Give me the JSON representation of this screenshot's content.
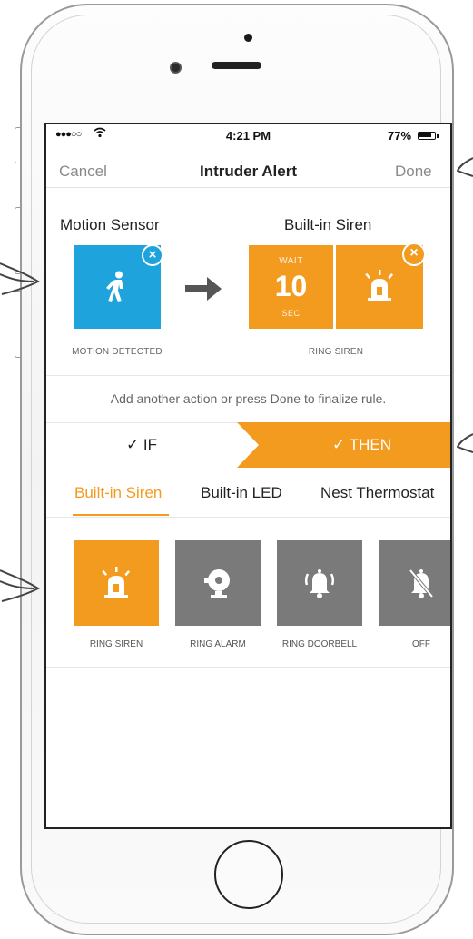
{
  "status_bar": {
    "signal": "●●●○○",
    "time": "4:21 PM",
    "battery": "77%",
    "battery_level": 0.77
  },
  "nav": {
    "cancel": "Cancel",
    "title": "Intruder Alert",
    "done": "Done"
  },
  "rule": {
    "trigger": {
      "device": "Motion Sensor",
      "caption": "MOTION DETECTED",
      "icon": "walking-person-icon",
      "color": "#1fa3dc"
    },
    "action": {
      "device": "Built-in Siren",
      "wait_label": "WAIT",
      "wait_value": "10",
      "wait_unit": "SEC",
      "caption": "RING SIREN",
      "icon": "siren-icon",
      "color": "#f39b1f"
    }
  },
  "hint": "Add another action or press Done to finalize rule.",
  "steps": {
    "if": "✓ IF",
    "then": "✓ THEN"
  },
  "tabs": [
    "Built-in Siren",
    "Built-in LED",
    "Nest Thermostat"
  ],
  "actions": [
    {
      "label": "RING SIREN",
      "icon": "siren-icon",
      "selected": true
    },
    {
      "label": "RING ALARM",
      "icon": "alarm-bell-icon",
      "selected": false
    },
    {
      "label": "RING DOORBELL",
      "icon": "ringing-bell-icon",
      "selected": false
    },
    {
      "label": "OFF",
      "icon": "bell-off-icon",
      "selected": false
    }
  ],
  "colors": {
    "accent": "#f39b1f",
    "trigger": "#1fa3dc",
    "inactive": "#7a7a7a"
  }
}
